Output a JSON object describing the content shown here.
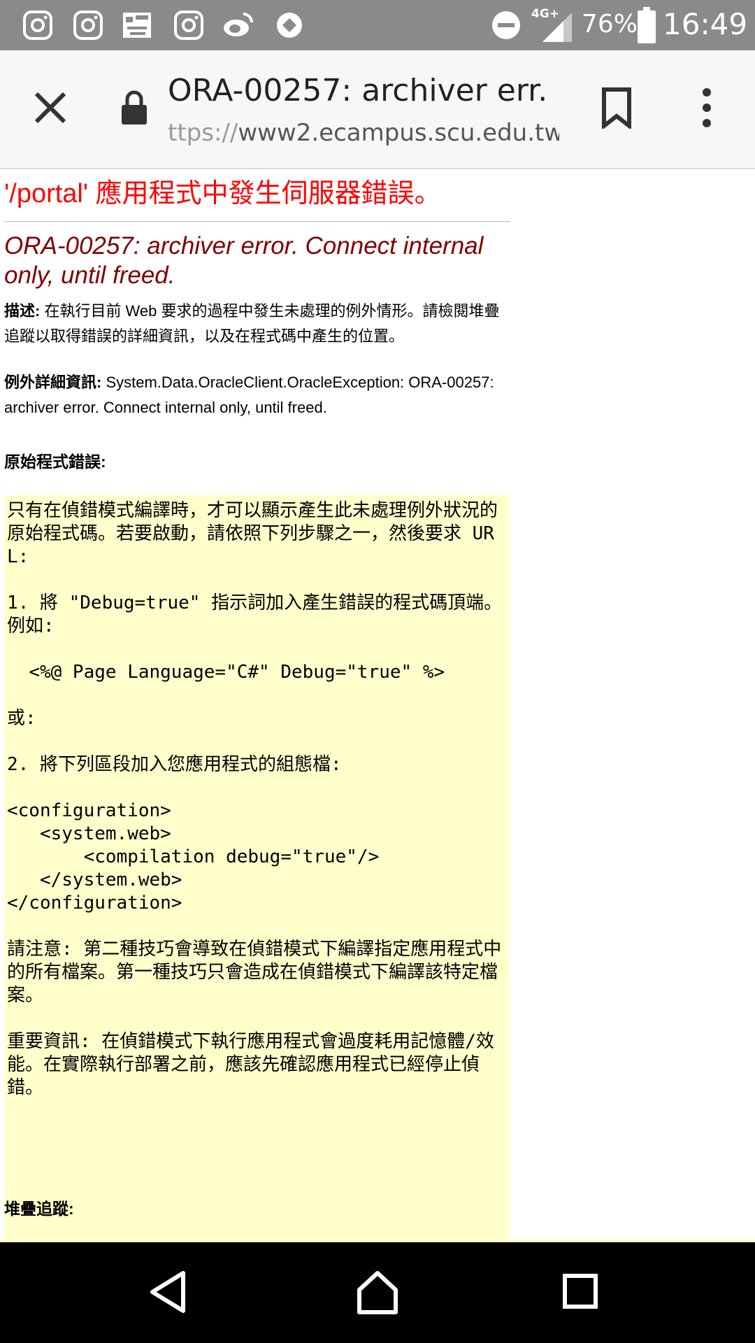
{
  "status_bar": {
    "battery_percent": "76%",
    "network": "4G+",
    "time": "16:49",
    "left_icons": [
      "instagram-icon",
      "instagram-icon",
      "image-icon",
      "instagram-icon",
      "weibo-icon",
      "app-icon"
    ]
  },
  "browser": {
    "page_title": "ORA-00257: archiver err...",
    "url_scheme": "ttps://",
    "url_host": "www2.ecampus.scu.edu.tw"
  },
  "page": {
    "heading": "'/portal' 應用程式中發生伺服器錯誤。",
    "error_title": "ORA-00257: archiver error. Connect internal only, until freed.",
    "description_label": "描述:",
    "description_text": " 在執行目前 Web 要求的過程中發生未處理的例外情形。請檢閱堆疊追蹤以取得錯誤的詳細資訊，以及在程式碼中產生的位置。",
    "exception_label": "例外詳細資訊:",
    "exception_text": " System.Data.OracleClient.OracleException: ORA-00257: archiver error. Connect internal only, until freed.",
    "source_error_label": "原始程式錯誤:",
    "source_error_block": "只有在偵錯模式編譯時，才可以顯示產生此未處理例外狀況的原始程式碼。若要啟動，請依照下列步驟之一，然後要求 URL:\n\n1. 將 \"Debug=true\" 指示詞加入產生錯誤的程式碼頂端。例如:\n\n  <%@ Page Language=\"C#\" Debug=\"true\" %>\n\n或:\n\n2. 將下列區段加入您應用程式的組態檔:\n\n<configuration>\n   <system.web>\n       <compilation debug=\"true\"/>\n   </system.web>\n</configuration>\n\n請注意: 第二種技巧會導致在偵錯模式下編譯指定應用程式中的所有檔案。第一種技巧只會造成在偵錯模式下編譯該特定檔案。\n\n重要資訊: 在偵錯模式下執行應用程式會過度耗用記憶體/效能。在實際執行部署之前，應該先確認應用程式已經停止偵錯。",
    "stack_trace_label": "堆疊追蹤:"
  },
  "colors": {
    "heading_red": "#ff0000",
    "error_maroon": "#800000",
    "code_block_bg": "#ffffcc",
    "status_bar_bg": "#8a8a8a"
  }
}
